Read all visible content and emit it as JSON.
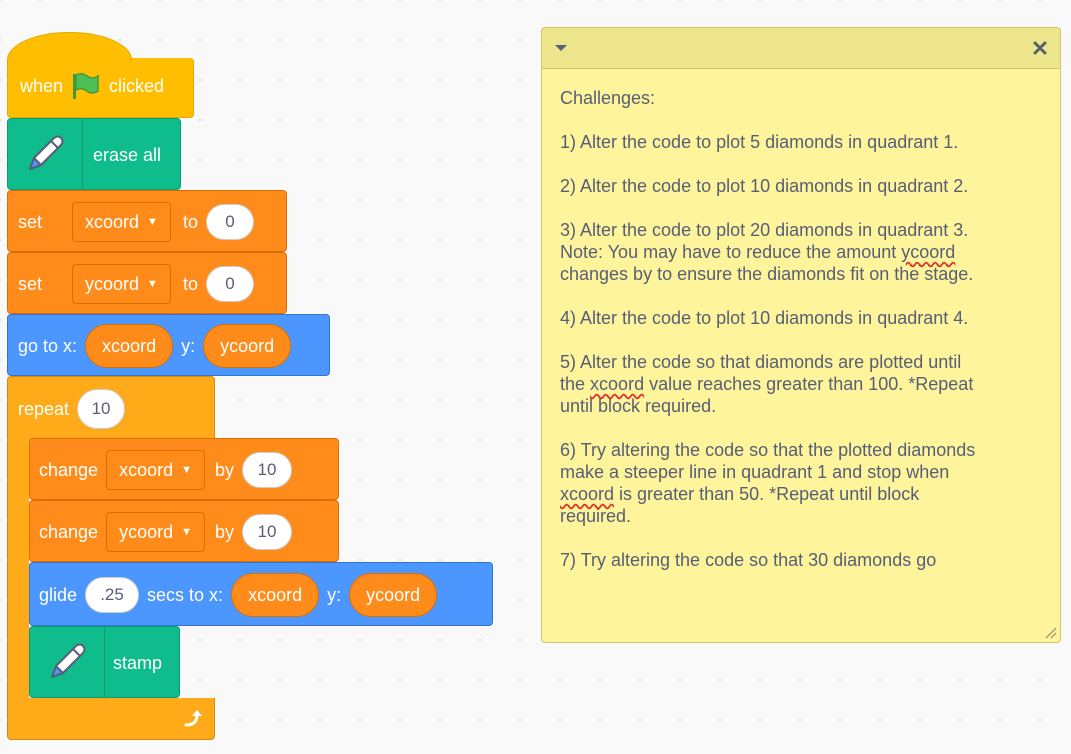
{
  "script": {
    "when_flag": {
      "before": "when",
      "after": "clicked"
    },
    "erase_all": {
      "label": "erase all"
    },
    "set_x": {
      "label": "set",
      "variable": "xcoord",
      "to": "to",
      "value": "0"
    },
    "set_y": {
      "label": "set",
      "variable": "ycoord",
      "to": "to",
      "value": "0"
    },
    "goto": {
      "label": "go to x:",
      "x_var": "xcoord",
      "y_label": "y:",
      "y_var": "ycoord"
    },
    "repeat": {
      "label": "repeat",
      "value": "10"
    },
    "change_x": {
      "label": "change",
      "variable": "xcoord",
      "by": "by",
      "value": "10"
    },
    "change_y": {
      "label": "change",
      "variable": "ycoord",
      "by": "by",
      "value": "10"
    },
    "glide": {
      "label": "glide",
      "secs": ".25",
      "secs_label": "secs to x:",
      "x_var": "xcoord",
      "y_label": "y:",
      "y_var": "ycoord"
    },
    "stamp": {
      "label": "stamp"
    }
  },
  "note": {
    "title": "Challenges:",
    "c1": "1) Alter the code to plot 5 diamonds in quadrant 1.",
    "c2": "2) Alter the code to plot 10 diamonds in quadrant 2.",
    "c3a": "3) Alter the code to plot 20 diamonds in quadrant 3.",
    "c3b": "Note: You may have to reduce the amount",
    "c3c": "ycoord",
    "c3d": "changes by to ensure the diamonds fit on the stage.",
    "c4": "4) Alter the code to plot 10 diamonds in quadrant 4.",
    "c5a": "5) Alter the code so that diamonds are plotted until",
    "c5b": "the",
    "c5c": "xcoord",
    "c5d": "value reaches greater than 100. *Repeat",
    "c5e": "until block required.",
    "c6a": "6) Try altering the code so that the plotted diamonds",
    "c6b": "make a steeper line in quadrant 1 and stop when",
    "c6c": "xcoord",
    "c6d": "is greater than 50. *Repeat until block",
    "c6e": "required.",
    "c7": "7) Try altering the code so that 30 diamonds go"
  },
  "colors": {
    "events": "#ffbf00",
    "pen": "#0fbd8c",
    "variables": "#ff8c1a",
    "motion": "#4c97ff",
    "control": "#ffab19",
    "note_bg": "#fef49c"
  },
  "icons": {
    "flag": "green-flag-icon",
    "pen": "pen-icon",
    "loop": "loop-arrow-icon",
    "collapse": "chevron-down-icon",
    "close": "close-icon",
    "resize": "resize-handle-icon"
  }
}
